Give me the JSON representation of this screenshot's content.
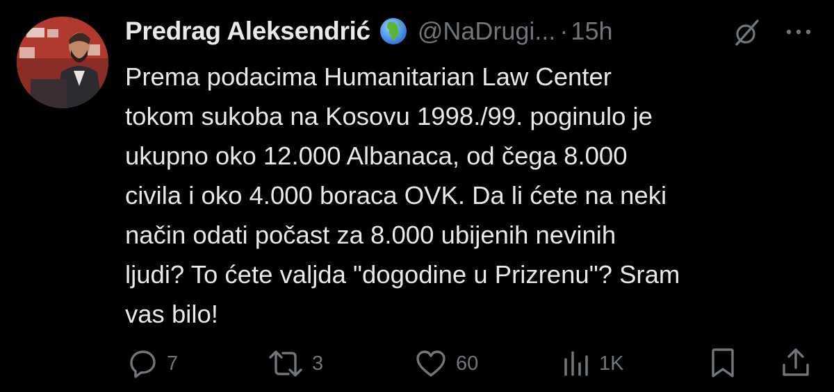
{
  "tweet": {
    "author": {
      "display_name": "Predrag Aleksendrić",
      "badge_icon": "globe-africa-icon",
      "handle": "@NaDrugi...",
      "separator": "·",
      "time": "15h"
    },
    "text_lines": [
      "Prema podacima Humanitarian Law Center",
      "tokom sukoba na Kosovu 1998./99. poginulo je",
      "ukupno oko 12.000 Albanaca, od čega 8.000",
      "civila i oko 4.000 boraca OVK. Da li ćete na neki",
      "način odati počast za 8.000 ubijenih nevinih",
      "ljudi? To ćete valjda \"dogodine u Prizrenu\"? Sram",
      "vas bilo!"
    ],
    "actions": {
      "replies": "7",
      "reposts": "3",
      "likes": "60",
      "views": "1K"
    }
  },
  "colors": {
    "background": "#000000",
    "text_primary": "#e7e9ea",
    "text_secondary": "#71767b",
    "avatar_bg": "#7a2a24"
  },
  "icons": [
    "grok-icon",
    "more-icon",
    "reply-icon",
    "repost-icon",
    "like-icon",
    "views-icon",
    "bookmark-icon",
    "share-icon"
  ]
}
